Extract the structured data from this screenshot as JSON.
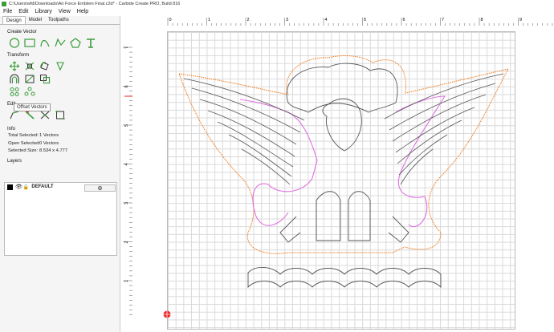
{
  "window": {
    "title": "C:\\Users\\wfd\\Downloads\\Air Force Emblem Final.c2d* - Carbide Create PRO, Build 816"
  },
  "menu": [
    "File",
    "Edit",
    "Library",
    "View",
    "Help"
  ],
  "tabs": [
    "Design",
    "Model",
    "Toolpaths"
  ],
  "create_vector": {
    "title": "Create Vector",
    "icons": [
      "circle-icon",
      "rectangle-icon",
      "curve-icon",
      "polyline-icon",
      "polygon-icon",
      "text-icon"
    ]
  },
  "transform": {
    "title": "Transform",
    "icons": [
      "move-icon",
      "align-icon",
      "rotate-icon",
      "mirror-icon",
      "offset-icon",
      "node-edit-icon",
      "boolean-icon",
      "group-icon",
      "array-icon",
      "pattern-icon"
    ]
  },
  "tooltip": "Offset Vectors",
  "edit": {
    "title": "Edit",
    "icons": [
      "pen-icon",
      "knife-icon",
      "cut-icon",
      "scale-icon"
    ]
  },
  "info": {
    "title": "Info",
    "total_selected_label": "Total Selected:",
    "total_selected_value": "1 Vectors",
    "open_selected_label": "Open Selected:",
    "open_selected_value": "0 Vectors",
    "selected_size_label": "Selected Size:",
    "selected_size_value": "8.534 x 4.777"
  },
  "layers": {
    "title": "Layers",
    "items": [
      {
        "name": "DEFAULT"
      }
    ]
  },
  "rulers": {
    "x_labels": [
      "0",
      "1",
      "2",
      "3",
      "4",
      "5",
      "6",
      "7",
      "8",
      "9"
    ],
    "y_labels": [
      "7",
      "6",
      "5",
      "4",
      "3",
      "2",
      "1"
    ]
  },
  "colors": {
    "accent": "#3a9d3a",
    "vector_gray": "#555555",
    "offset_orange": "#f07a1a",
    "selected_pink": "#e070e0"
  }
}
